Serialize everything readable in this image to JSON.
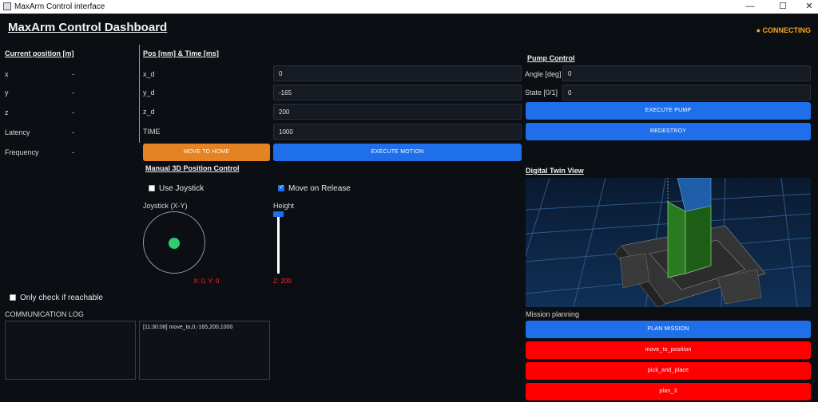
{
  "window": {
    "title": "MaxArm Control interface",
    "minimize": "—",
    "maximize": "☐",
    "close": "✕"
  },
  "header": {
    "title": "MaxArm Control Dashboard",
    "status": "● CONNECTING"
  },
  "current_position": {
    "title": "Current position [m]",
    "rows": [
      {
        "label": "x",
        "value": "-"
      },
      {
        "label": "y",
        "value": "-"
      },
      {
        "label": "z",
        "value": "-"
      },
      {
        "label": "Latency",
        "value": "-"
      },
      {
        "label": "Frequency",
        "value": "-"
      }
    ]
  },
  "motion": {
    "title": "Pos [mm] & Time [ms]",
    "fields": [
      {
        "label": "x_d",
        "value": "0"
      },
      {
        "label": "y_d",
        "value": "-165"
      },
      {
        "label": "z_d",
        "value": "200"
      },
      {
        "label": "TIME",
        "value": "1000"
      }
    ],
    "home_button": "MOVE TO HOME",
    "execute_button": "EXECUTE MOTION"
  },
  "pump": {
    "title": "Pump Control",
    "angle_label": "Angle [deg]",
    "angle_value": "0",
    "state_label": "State [0/1]",
    "state_value": "0",
    "execute_button": "EXECUTE PUMP",
    "redestroy_button": "REDESTROY"
  },
  "manual": {
    "title": "Manual 3D Position Control",
    "use_joystick": {
      "label": "Use Joystick",
      "checked": false
    },
    "move_on_release": {
      "label": "Move on Release",
      "checked": true
    },
    "joystick_label": "Joystick (X-Y)",
    "joystick_readout": "X: 0, Y: 0",
    "height_label": "Height",
    "height_readout": "Z: 200"
  },
  "reachable": {
    "label": "Only check if reachable",
    "checked": false
  },
  "log": {
    "title": "COMMUNICATION LOG",
    "entries": "[11:30:08] move_to,0,-165,200,1000"
  },
  "twin": {
    "title": "Digital Twin View"
  },
  "mission": {
    "title": "Mission planning",
    "plan_button": "PLAN MISSION",
    "items": [
      "move_to_position",
      "pick_and_place",
      "plan_3"
    ]
  },
  "colors": {
    "accent": "#1f6feb",
    "home": "#e48324",
    "mission_item": "#ff0000",
    "status": "#f5a623",
    "joystick_knob": "#2ecc71"
  }
}
